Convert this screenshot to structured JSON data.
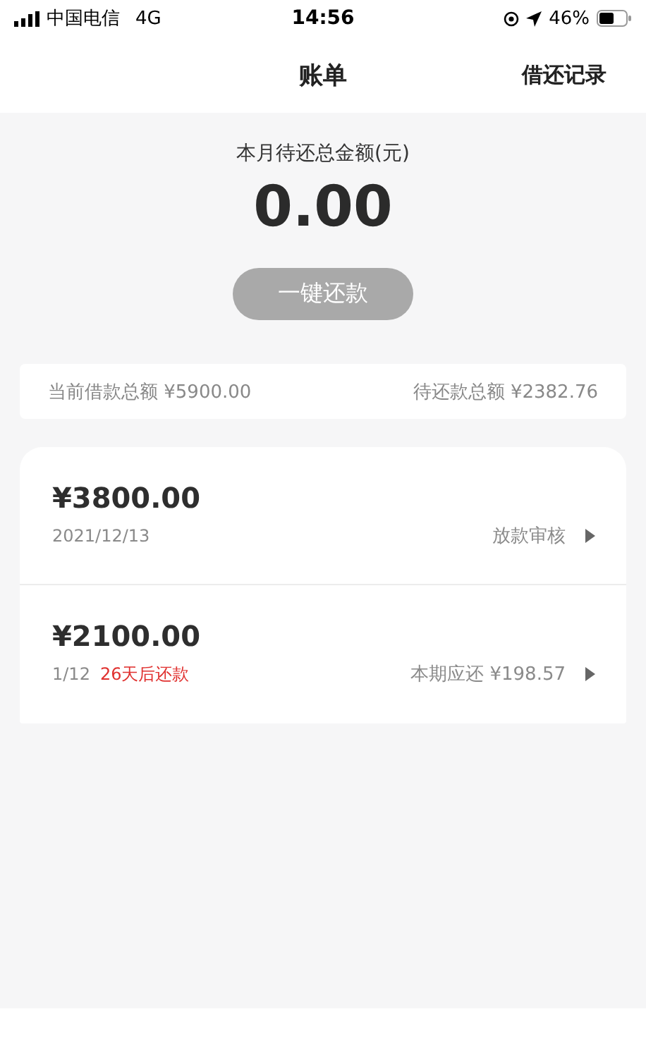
{
  "status_bar": {
    "carrier": "中国电信",
    "network": "4G",
    "time": "14:56",
    "battery": "46%"
  },
  "nav": {
    "title": "账单",
    "action": "借还记录"
  },
  "summary": {
    "label": "本月待还总金额(元)",
    "amount": "0.00",
    "button": {
      "label": "一键还款",
      "disabled": true
    }
  },
  "totals": [
    {
      "label": "当前借款总额",
      "value": "¥5900.00"
    },
    {
      "label": "待还款总额",
      "value": "¥2382.76"
    }
  ],
  "loans": [
    {
      "amount": "¥3800.00",
      "details": [
        {
          "text": "2021/12/13",
          "alert": false
        }
      ],
      "status": "放款审核"
    },
    {
      "amount": "¥2100.00",
      "details": [
        {
          "text": "1/12",
          "alert": false
        },
        {
          "text": "26天后还款",
          "alert": true
        }
      ],
      "status": "本期应还 ¥198.57"
    }
  ]
}
